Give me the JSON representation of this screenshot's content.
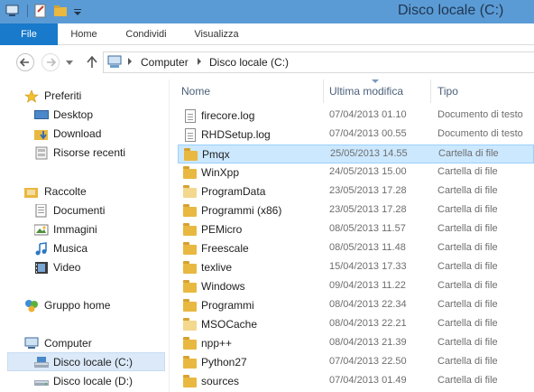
{
  "window": {
    "title": "Disco locale (C:)"
  },
  "ribbon": {
    "tabs": [
      "File",
      "Home",
      "Condividi",
      "Visualizza"
    ]
  },
  "address": {
    "segments": [
      "Computer",
      "Disco locale (C:)"
    ]
  },
  "columns": {
    "name": "Nome",
    "modified": "Ultima modifica",
    "type": "Tipo"
  },
  "navpane": {
    "favorites": {
      "label": "Preferiti",
      "items": [
        "Desktop",
        "Download",
        "Risorse recenti"
      ]
    },
    "libraries": {
      "label": "Raccolte",
      "items": [
        "Documenti",
        "Immagini",
        "Musica",
        "Video"
      ]
    },
    "homegroup": "Gruppo home",
    "computer": {
      "label": "Computer",
      "items": [
        "Disco locale (C:)",
        "Disco locale (D:)"
      ]
    }
  },
  "files": [
    {
      "name": "firecore.log",
      "date": "07/04/2013 01.10",
      "type": "Documento di testo",
      "kind": "doc"
    },
    {
      "name": "RHDSetup.log",
      "date": "07/04/2013 00.55",
      "type": "Documento di testo",
      "kind": "doc"
    },
    {
      "name": "Pmqx",
      "date": "25/05/2013 14.55",
      "type": "Cartella di file",
      "kind": "folder"
    },
    {
      "name": "WinXpp",
      "date": "24/05/2013 15.00",
      "type": "Cartella di file",
      "kind": "folder"
    },
    {
      "name": "ProgramData",
      "date": "23/05/2013 17.28",
      "type": "Cartella di file",
      "kind": "folder-light"
    },
    {
      "name": "Programmi (x86)",
      "date": "23/05/2013 17.28",
      "type": "Cartella di file",
      "kind": "folder"
    },
    {
      "name": "PEMicro",
      "date": "08/05/2013 11.57",
      "type": "Cartella di file",
      "kind": "folder"
    },
    {
      "name": "Freescale",
      "date": "08/05/2013 11.48",
      "type": "Cartella di file",
      "kind": "folder"
    },
    {
      "name": "texlive",
      "date": "15/04/2013 17.33",
      "type": "Cartella di file",
      "kind": "folder"
    },
    {
      "name": "Windows",
      "date": "09/04/2013 11.22",
      "type": "Cartella di file",
      "kind": "folder"
    },
    {
      "name": "Programmi",
      "date": "08/04/2013 22.34",
      "type": "Cartella di file",
      "kind": "folder"
    },
    {
      "name": "MSOCache",
      "date": "08/04/2013 22.21",
      "type": "Cartella di file",
      "kind": "folder-light"
    },
    {
      "name": "npp++",
      "date": "08/04/2013 21.39",
      "type": "Cartella di file",
      "kind": "folder"
    },
    {
      "name": "Python27",
      "date": "07/04/2013 22.50",
      "type": "Cartella di file",
      "kind": "folder"
    },
    {
      "name": "sources",
      "date": "07/04/2013 01.49",
      "type": "Cartella di file",
      "kind": "folder"
    }
  ],
  "selected_file": "Pmqx",
  "selected_nav": "Disco locale (C:)",
  "colors": {
    "titlebar": "#5b9bd5",
    "file_tab": "#1979ca",
    "selection": "#cce8ff"
  }
}
